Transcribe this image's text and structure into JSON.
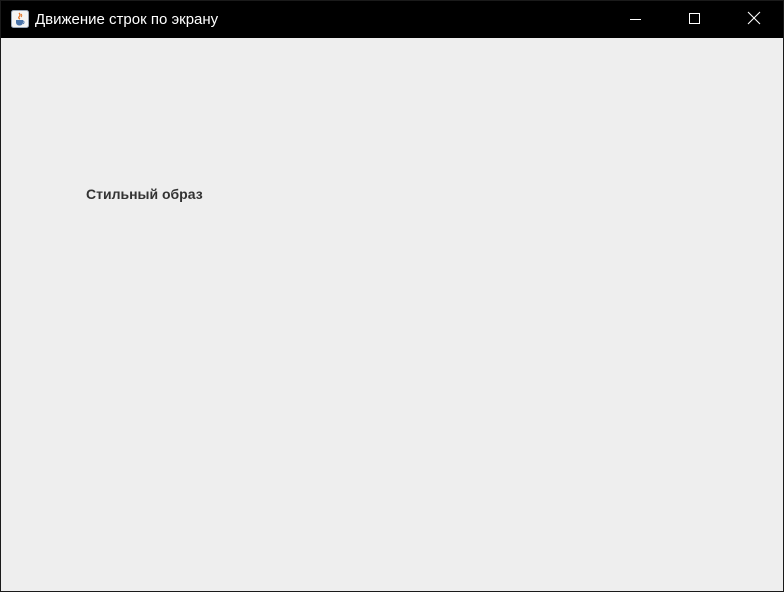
{
  "window": {
    "title": "Движение строк по экрану",
    "icon": "java-cup-icon",
    "controls": {
      "minimize_icon": "minimize-icon",
      "maximize_icon": "maximize-icon",
      "close_icon": "close-icon"
    }
  },
  "content": {
    "label_text": "Стильный образ"
  },
  "colors": {
    "titlebar_bg": "#000000",
    "title_text": "#ffffff",
    "content_bg": "#eeeeee",
    "label_text": "#333333"
  }
}
